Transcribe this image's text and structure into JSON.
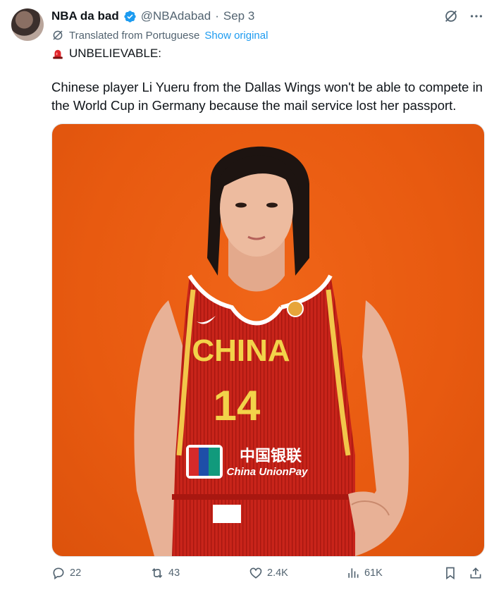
{
  "author": {
    "name": "NBA da bad",
    "handle": "@NBAdabad",
    "separator": "·",
    "date": "Sep 3",
    "verified_color": "#1d9bf0"
  },
  "translation": {
    "label": "Translated from Portuguese",
    "show_original": "Show original"
  },
  "tweet": {
    "headline": "UNBELIEVABLE:",
    "body": "Chinese player Li Yueru from the Dallas Wings won't be able to compete in the World Cup in Germany because the mail service lost her passport."
  },
  "media": {
    "jersey_text": "CHINA",
    "jersey_number": "14",
    "sponsor_cn": "中国银联",
    "sponsor_en": "China UnionPay",
    "sponsor_logo": "UnionPay\n银联",
    "background_color": "#e85a10"
  },
  "actions": {
    "replies": "22",
    "reposts": "43",
    "likes": "2.4K",
    "views": "61K"
  },
  "icons": {
    "verified": "verified-badge-icon",
    "grok": "grok-icon",
    "more": "more-icon",
    "translate": "translate-icon",
    "siren": "siren-icon",
    "reply": "reply-icon",
    "repost": "repost-icon",
    "like": "like-icon",
    "views": "views-icon",
    "bookmark": "bookmark-icon",
    "share": "share-icon"
  }
}
